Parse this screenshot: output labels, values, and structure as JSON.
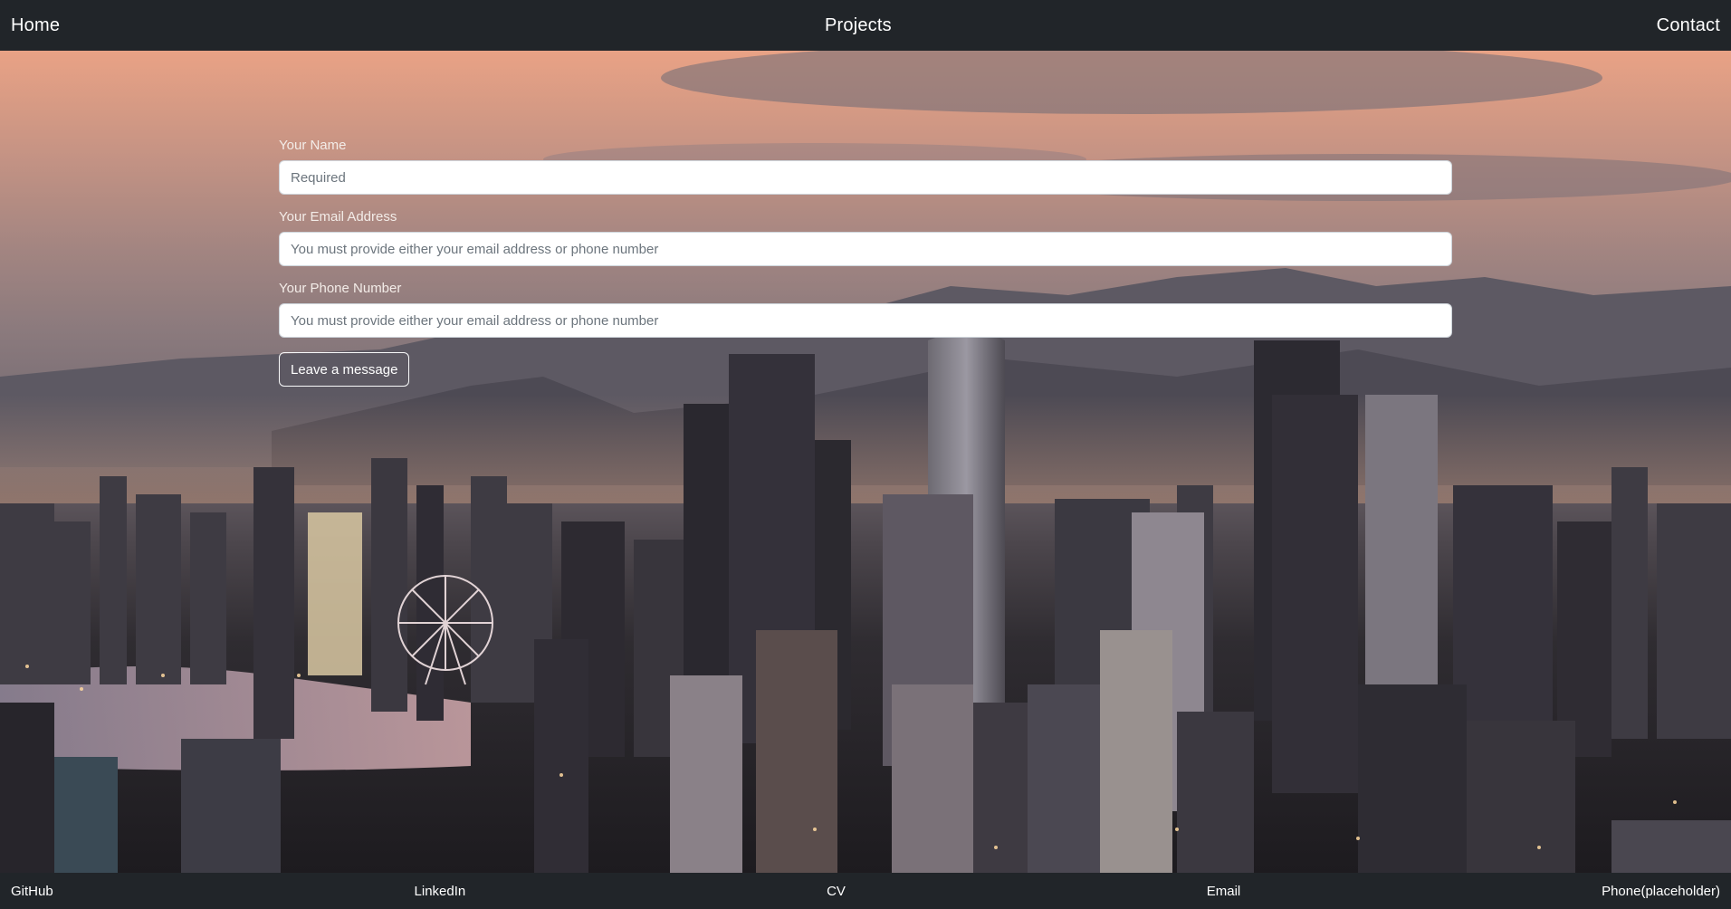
{
  "navbar": {
    "home": "Home",
    "projects": "Projects",
    "contact": "Contact"
  },
  "form": {
    "name": {
      "label": "Your Name",
      "placeholder": "Required",
      "value": ""
    },
    "email": {
      "label": "Your Email Address",
      "placeholder": "You must provide either your email address or phone number",
      "value": ""
    },
    "phone": {
      "label": "Your Phone Number",
      "placeholder": "You must provide either your email address or phone number",
      "value": ""
    },
    "submit_label": "Leave a message"
  },
  "footer": {
    "github": "GitHub",
    "linkedin": "LinkedIn",
    "cv": "CV",
    "email": "Email",
    "phone": "Phone(placeholder)"
  },
  "background": {
    "description_icon": "city-skyline-image"
  },
  "colors": {
    "bar": "#212529",
    "sky_top": "#e9a285",
    "button_border": "#f8f9fa"
  }
}
